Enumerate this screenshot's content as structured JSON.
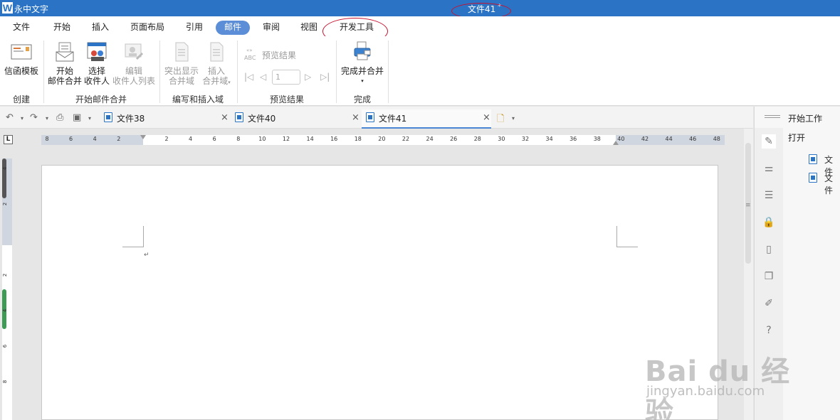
{
  "titlebar": {
    "app_logo": "W",
    "app_name": "永中文字",
    "doc_title": "文件41",
    "modified_mark": "*"
  },
  "menu": {
    "tabs": [
      "文件",
      "开始",
      "插入",
      "页面布局",
      "引用",
      "邮件",
      "审阅",
      "视图",
      "开发工具"
    ],
    "active": "邮件"
  },
  "ribbon": {
    "letter_template": "信函模板",
    "start_merge_line1": "开始",
    "start_merge_line2": "邮件合并",
    "select_recipients_line1": "选择",
    "select_recipients_line2": "收件人",
    "edit_recipients_line1": "编辑",
    "edit_recipients_line2": "收件人列表",
    "highlight_fields_line1": "突出显示",
    "highlight_fields_line2": "合并域",
    "insert_field_line1": "插入",
    "insert_field_line2": "合并域",
    "preview_results": "预览结果",
    "record_number": "1",
    "finish_merge": "完成并合并",
    "groups": {
      "create": "创建",
      "start_mail_merge": "开始邮件合并",
      "write_insert": "编写和插入域",
      "preview": "预览结果",
      "finish": "完成"
    }
  },
  "doc_tabs": [
    {
      "label": "文件38",
      "active": false
    },
    {
      "label": "文件40",
      "active": false
    },
    {
      "label": "文件41",
      "active": true
    }
  ],
  "ruler": {
    "corner": "L",
    "h_ticks": [
      "8",
      "6",
      "4",
      "2",
      "2",
      "4",
      "6",
      "8",
      "10",
      "12",
      "14",
      "16",
      "18",
      "20",
      "22",
      "24",
      "26",
      "28",
      "30",
      "32",
      "34",
      "36",
      "38",
      "40",
      "42",
      "44",
      "46",
      "48"
    ],
    "v_ticks": [
      "4",
      "2",
      "2",
      "4",
      "6",
      "8"
    ]
  },
  "editor": {
    "paragraph_mark": "↵"
  },
  "taskpane": {
    "title": "开始工作",
    "open_label": "打开",
    "recent_files": [
      "文件",
      "文件"
    ],
    "icons": [
      "pencil-icon",
      "sliders-icon",
      "outline-icon",
      "lock-icon",
      "clipboard-icon",
      "copy-icon",
      "edit-icon",
      "help-icon"
    ]
  },
  "watermark": {
    "brand": "Bai du 经验",
    "url": "jingyan.baidu.com"
  },
  "colors": {
    "titlebar": "#2b74c5",
    "active_tab": "#5b8ed6",
    "annotation": "#c8102e",
    "doc_icon": "#2b74c5"
  }
}
